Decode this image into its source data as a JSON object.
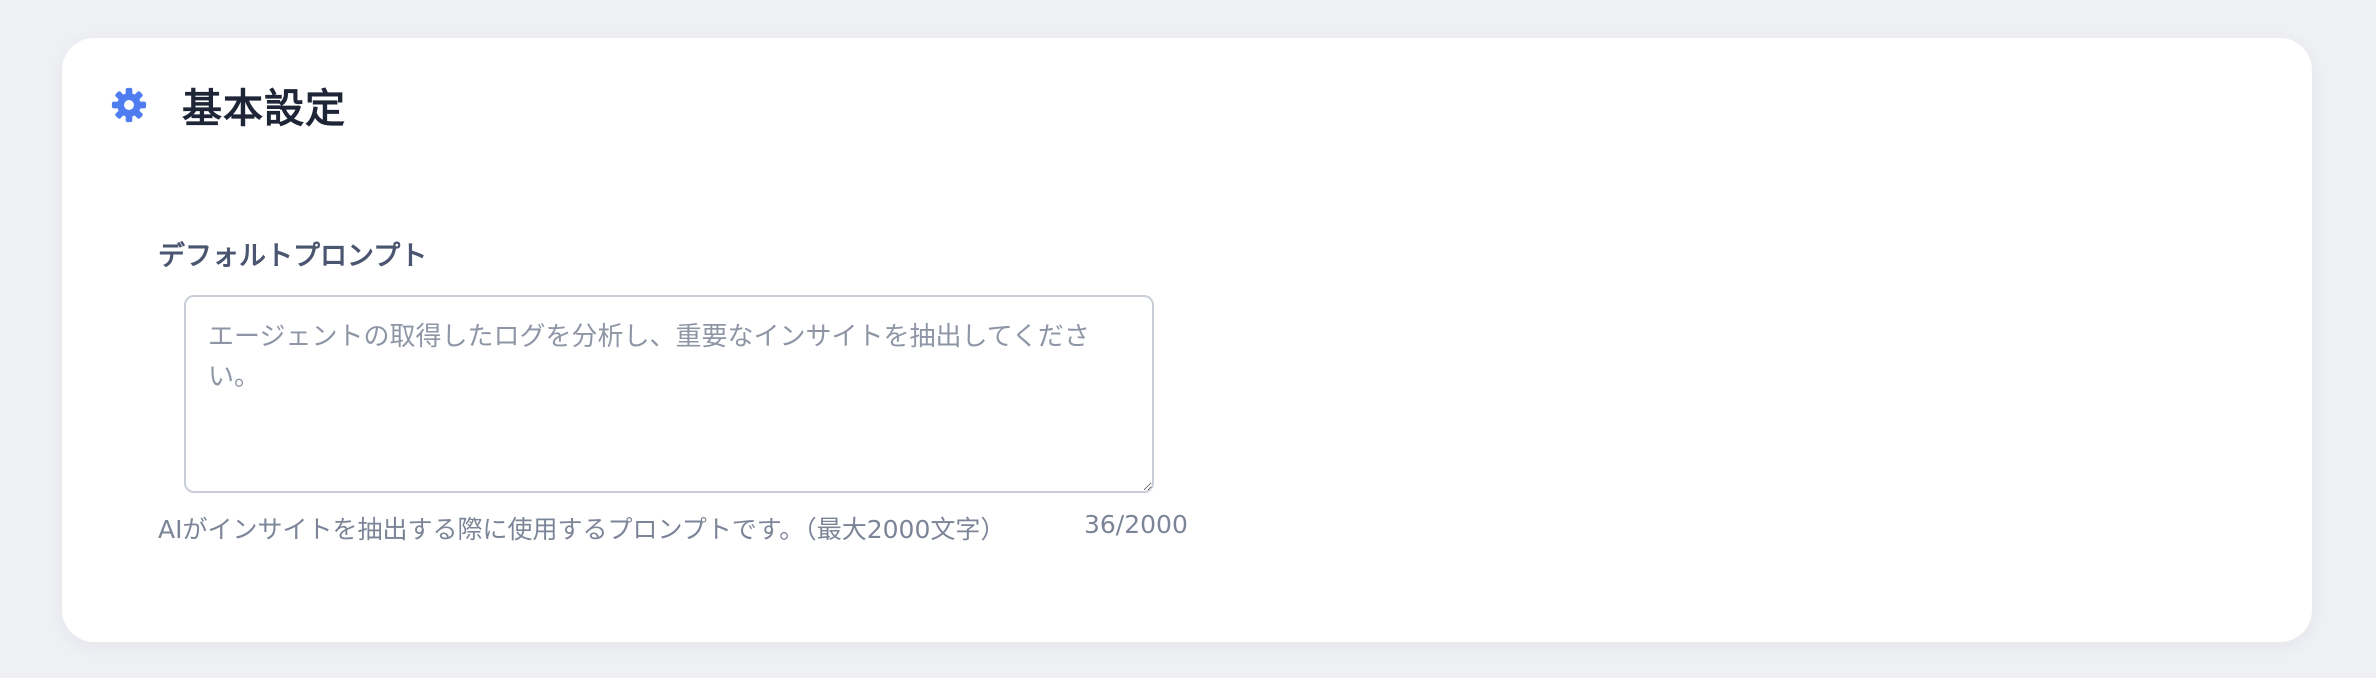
{
  "section": {
    "title": "基本設定",
    "icon": "gear-icon",
    "accent_color": "#4f7df0"
  },
  "prompt_field": {
    "label": "デフォルトプロンプト",
    "placeholder": "エージェントの取得したログを分析し、重要なインサイトを抽出してください。",
    "value": "",
    "help_text": "AIがインサイトを抽出する際に使用するプロンプトです。（最大2000文字）",
    "counter": "36/2000"
  }
}
